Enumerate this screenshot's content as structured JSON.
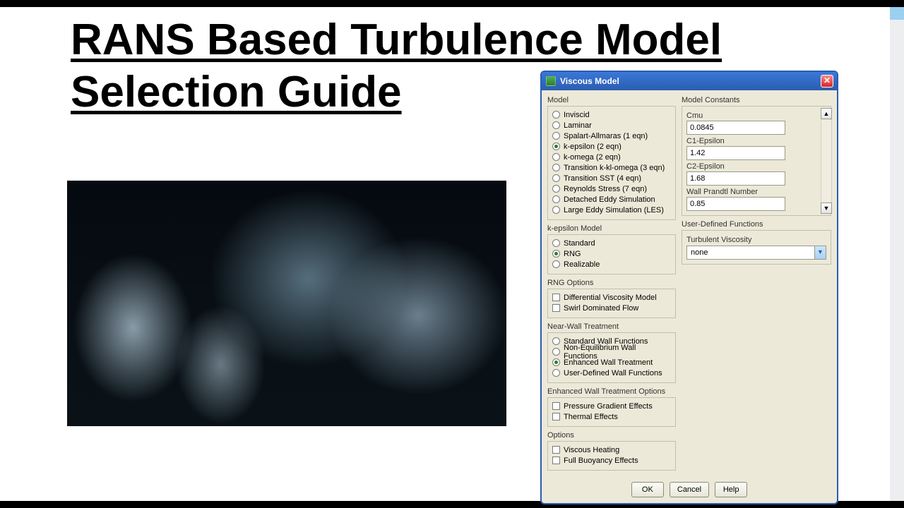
{
  "page": {
    "title_line1": "RANS Based Turbulence Model",
    "title_line2": "Selection Guide"
  },
  "dialog": {
    "title": "Viscous Model",
    "model": {
      "label": "Model",
      "options": [
        {
          "label": "Inviscid",
          "checked": false
        },
        {
          "label": "Laminar",
          "checked": false
        },
        {
          "label": "Spalart-Allmaras (1 eqn)",
          "checked": false
        },
        {
          "label": "k-epsilon (2 eqn)",
          "checked": true
        },
        {
          "label": "k-omega (2 eqn)",
          "checked": false
        },
        {
          "label": "Transition k-kl-omega (3 eqn)",
          "checked": false
        },
        {
          "label": "Transition SST (4 eqn)",
          "checked": false
        },
        {
          "label": "Reynolds Stress (7 eqn)",
          "checked": false
        },
        {
          "label": "Detached Eddy Simulation",
          "checked": false
        },
        {
          "label": "Large Eddy Simulation (LES)",
          "checked": false
        }
      ]
    },
    "ke_model": {
      "label": "k-epsilon Model",
      "options": [
        {
          "label": "Standard",
          "checked": false
        },
        {
          "label": "RNG",
          "checked": true
        },
        {
          "label": "Realizable",
          "checked": false
        }
      ]
    },
    "rng_options": {
      "label": "RNG Options",
      "options": [
        {
          "label": "Differential Viscosity Model",
          "checked": false
        },
        {
          "label": "Swirl Dominated Flow",
          "checked": false
        }
      ]
    },
    "near_wall": {
      "label": "Near-Wall Treatment",
      "options": [
        {
          "label": "Standard Wall Functions",
          "checked": false
        },
        {
          "label": "Non-Equilibrium Wall Functions",
          "checked": false
        },
        {
          "label": "Enhanced Wall Treatment",
          "checked": true
        },
        {
          "label": "User-Defined Wall Functions",
          "checked": false
        }
      ]
    },
    "ewt_options": {
      "label": "Enhanced Wall Treatment Options",
      "options": [
        {
          "label": "Pressure Gradient Effects",
          "checked": false
        },
        {
          "label": "Thermal Effects",
          "checked": false
        }
      ]
    },
    "options": {
      "label": "Options",
      "options": [
        {
          "label": "Viscous Heating",
          "checked": false
        },
        {
          "label": "Full Buoyancy Effects",
          "checked": false
        }
      ]
    },
    "constants": {
      "label": "Model Constants",
      "fields": [
        {
          "label": "Cmu",
          "value": "0.0845"
        },
        {
          "label": "C1-Epsilon",
          "value": "1.42"
        },
        {
          "label": "C2-Epsilon",
          "value": "1.68"
        },
        {
          "label": "Wall Prandtl Number",
          "value": "0.85"
        }
      ]
    },
    "udf": {
      "label": "User-Defined Functions",
      "turb_visc_label": "Turbulent Viscosity",
      "turb_visc_value": "none"
    },
    "buttons": {
      "ok": "OK",
      "cancel": "Cancel",
      "help": "Help"
    }
  }
}
